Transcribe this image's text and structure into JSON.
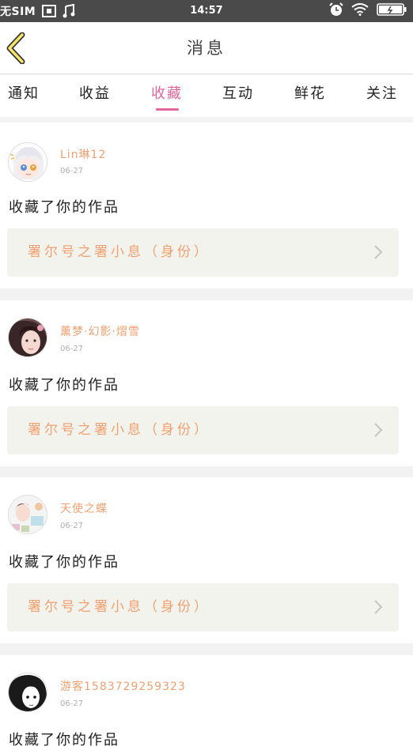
{
  "status_bar": {
    "carrier": "无SIM",
    "time": "14:57"
  },
  "nav": {
    "title": "消息"
  },
  "tabs": [
    {
      "label": "通知"
    },
    {
      "label": "收益"
    },
    {
      "label": "收藏"
    },
    {
      "label": "互动"
    },
    {
      "label": "鲜花"
    },
    {
      "label": "关注"
    }
  ],
  "active_tab": "收藏",
  "colors": {
    "accent": "#e0669a",
    "name": "#f0a070",
    "work_bg": "#f3f3ed",
    "status_bar": "#4a4a4a"
  },
  "messages": [
    {
      "user": "Lin琳12",
      "date": "06-27",
      "action": "收藏了你的作品",
      "work": "署尔号之署小息（身份）",
      "avatar": "anime-girl-avatar"
    },
    {
      "user": "薰梦·幻影·熠雪",
      "date": "06-27",
      "action": "收藏了你的作品",
      "work": "署尔号之署小息（身份）",
      "avatar": "girl-photo-avatar"
    },
    {
      "user": "天使之蝶",
      "date": "06-27",
      "action": "收藏了你的作品",
      "work": "署尔号之署小息（身份）",
      "avatar": "collage-avatar"
    },
    {
      "user": "游客1583729259323",
      "date": "06-27",
      "action": "收藏了你的作品",
      "avatar": "manga-avatar"
    }
  ]
}
